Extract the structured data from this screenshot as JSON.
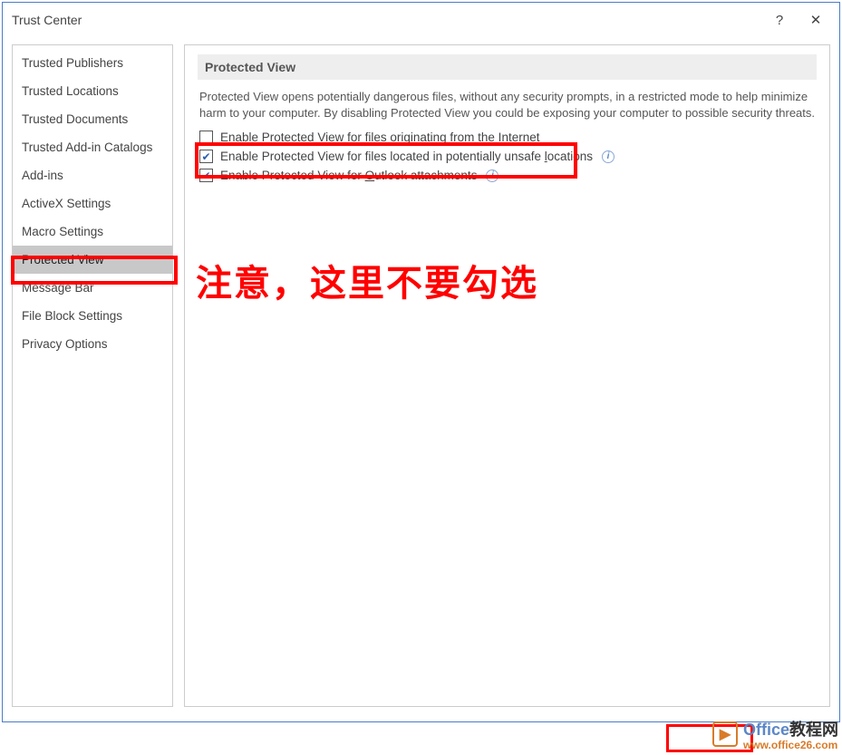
{
  "window": {
    "title": "Trust Center"
  },
  "sidebar": {
    "items": [
      {
        "label": "Trusted Publishers"
      },
      {
        "label": "Trusted Locations"
      },
      {
        "label": "Trusted Documents"
      },
      {
        "label": "Trusted Add-in Catalogs"
      },
      {
        "label": "Add-ins"
      },
      {
        "label": "ActiveX Settings"
      },
      {
        "label": "Macro Settings"
      },
      {
        "label": "Protected View"
      },
      {
        "label": "Message Bar"
      },
      {
        "label": "File Block Settings"
      },
      {
        "label": "Privacy Options"
      }
    ],
    "selected_index": 7
  },
  "content": {
    "header": "Protected View",
    "description": "Protected View opens potentially dangerous files, without any security prompts, in a restricted mode to help minimize harm to your computer. By disabling Protected View you could be exposing your computer to possible security threats.",
    "options": [
      {
        "checked": false,
        "pre": "Enable Protected View for files originating from the ",
        "u": "I",
        "post": "nternet",
        "info": false
      },
      {
        "checked": true,
        "pre": "Enable Protected View for files located in potentially unsafe ",
        "u": "l",
        "post": "ocations",
        "info": true
      },
      {
        "checked": true,
        "pre": "Enable Protected View for ",
        "u": "O",
        "post": "utlook attachments",
        "info": true
      }
    ]
  },
  "annotation": "注意，这里不要勾选",
  "watermark": {
    "brand": "Office",
    "brand_cn": "教程网",
    "url": "www.office26.com"
  }
}
